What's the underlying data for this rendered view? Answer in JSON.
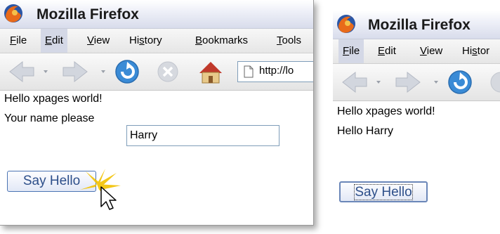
{
  "left_window": {
    "title": "Mozilla Firefox",
    "menu": [
      {
        "pre": "",
        "u": "F",
        "post": "ile"
      },
      {
        "pre": "",
        "u": "E",
        "post": "dit"
      },
      {
        "pre": "",
        "u": "V",
        "post": "iew"
      },
      {
        "pre": "Hi",
        "u": "s",
        "post": "tory"
      },
      {
        "pre": "",
        "u": "B",
        "post": "ookmarks"
      },
      {
        "pre": "",
        "u": "T",
        "post": "ools"
      }
    ],
    "url": "http://lo",
    "greeting": "Hello xpages world!",
    "prompt_label": "Your name please",
    "name_value": "Harry",
    "button_label": "Say Hello"
  },
  "right_window": {
    "title": "Mozilla Firefox",
    "menu": [
      {
        "pre": "",
        "u": "F",
        "post": "ile"
      },
      {
        "pre": "",
        "u": "E",
        "post": "dit"
      },
      {
        "pre": "",
        "u": "V",
        "post": "iew"
      },
      {
        "pre": "Hi",
        "u": "s",
        "post": "tor"
      }
    ],
    "greeting": "Hello xpages world!",
    "result": "Hello Harry",
    "button_label": "Say Hello"
  },
  "colors": {
    "titlebar": "#d8dceb",
    "menu_active": "#d4d8e6",
    "reload_blue": "#3a8bd6",
    "button_text": "#2d4f8a",
    "burst": "#f2c200"
  },
  "icons": [
    "firefox-logo",
    "back-arrow-icon",
    "forward-arrow-icon",
    "reload-icon",
    "stop-icon",
    "home-icon",
    "page-icon",
    "cursor-icon"
  ]
}
